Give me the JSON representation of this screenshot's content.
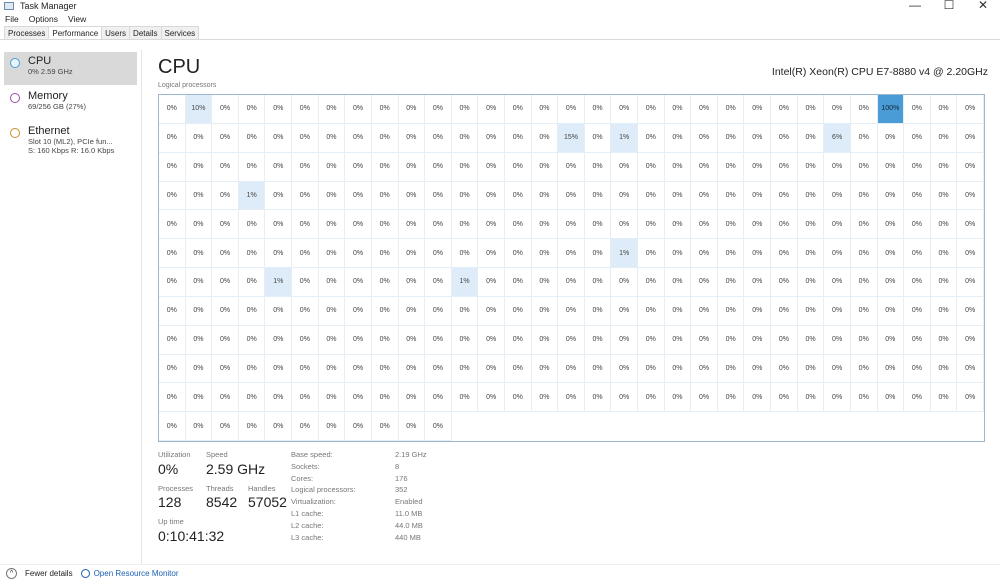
{
  "window": {
    "title": "Task Manager",
    "controls": [
      "—",
      "☐",
      "✕"
    ]
  },
  "menu": [
    "File",
    "Options",
    "View"
  ],
  "tabs": [
    "Processes",
    "Performance",
    "Users",
    "Details",
    "Services"
  ],
  "active_tab": "Performance",
  "sidebar": [
    {
      "name": "CPU",
      "sub1": "0% 2.59 GHz",
      "sub2": "",
      "color": "#4a9cd6"
    },
    {
      "name": "Memory",
      "sub1": "69/256 GB (27%)",
      "sub2": "",
      "color": "#a04ab0"
    },
    {
      "name": "Ethernet",
      "sub1": "Slot 10 (ML2), PCIe fun...",
      "sub2": "S: 160 Kbps  R: 16.0 Kbps",
      "color": "#c8902a"
    }
  ],
  "header": {
    "title": "CPU",
    "model": "Intel(R) Xeon(R) CPU E7-8880 v4 @ 2.20GHz",
    "grid_label": "Logical processors"
  },
  "grid": {
    "columns": 31,
    "total": 352,
    "nonzero": {
      "1": "10%",
      "27": "100%",
      "46": "15%",
      "48": "1%",
      "56": "6%",
      "96": "1%",
      "172": "1%",
      "190": "1%",
      "197": "1%"
    },
    "default": "0%"
  },
  "stats": {
    "utilization_label": "Utilization",
    "utilization": "0%",
    "speed_label": "Speed",
    "speed": "2.59 GHz",
    "processes_label": "Processes",
    "processes": "128",
    "threads_label": "Threads",
    "threads": "8542",
    "handles_label": "Handles",
    "handles": "57052",
    "uptime_label": "Up time",
    "uptime": "0:10:41:32"
  },
  "specs": [
    {
      "k": "Base speed:",
      "v": "2.19 GHz"
    },
    {
      "k": "Sockets:",
      "v": "8"
    },
    {
      "k": "Cores:",
      "v": "176"
    },
    {
      "k": "Logical processors:",
      "v": "352"
    },
    {
      "k": "Virtualization:",
      "v": "Enabled"
    },
    {
      "k": "L1 cache:",
      "v": "11.0 MB"
    },
    {
      "k": "L2 cache:",
      "v": "44.0 MB"
    },
    {
      "k": "L3 cache:",
      "v": "440 MB"
    }
  ],
  "footer": {
    "fewer": "Fewer details",
    "monitor": "Open Resource Monitor"
  }
}
